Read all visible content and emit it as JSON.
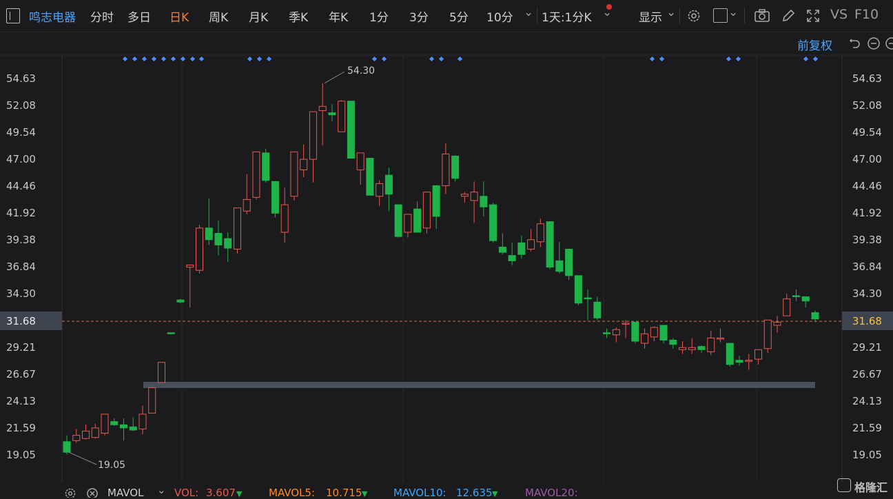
{
  "toolbar": {
    "stock_name": "鸣志电器",
    "periods": [
      "分时",
      "多日",
      "日K",
      "周K",
      "月K",
      "季K",
      "年K",
      "1分",
      "3分",
      "5分",
      "10分"
    ],
    "active_period": "日K",
    "interval": "1天:1分K",
    "display": "显示",
    "vs": "VS",
    "f10": "F10"
  },
  "chart_toolbar": {
    "adjust": "前复权"
  },
  "y_axis": {
    "ticks": [
      "54.63",
      "52.08",
      "49.54",
      "47.00",
      "44.46",
      "41.92",
      "39.38",
      "36.84",
      "34.30",
      "31.68",
      "29.21",
      "26.67",
      "24.13",
      "21.59",
      "19.05"
    ]
  },
  "annotations": {
    "high_label": "54.30",
    "low_label": "19.05",
    "current_price": "31.68"
  },
  "bottom_bar": {
    "indicator": "MAVOL",
    "vol_label": "VOL:",
    "vol_value": "3.607",
    "mavol5_label": "MAVOL5:",
    "mavol5_value": "10.715",
    "mavol10_label": "MAVOL10:",
    "mavol10_value": "12.635",
    "mavol20_label": "MAVOL20:",
    "watermark": "格隆汇"
  },
  "colors": {
    "up": "#e85a50",
    "down": "#1fb34a",
    "accent": "#ff7a2f",
    "link": "#4aa3ff",
    "bg": "#1b1b1d"
  },
  "chart_data": {
    "type": "candlestick",
    "ylim": [
      19.05,
      54.63
    ],
    "candles": [
      [
        20.3,
        19.3,
        20.9,
        19.1
      ],
      [
        20.4,
        20.9,
        21.5,
        20.2
      ],
      [
        20.6,
        21.3,
        21.9,
        20.5
      ],
      [
        20.7,
        21.6,
        22.0,
        20.6
      ],
      [
        21.1,
        22.9,
        22.9,
        20.9
      ],
      [
        22.2,
        21.9,
        22.5,
        21.8
      ],
      [
        21.9,
        21.6,
        22.5,
        20.4
      ],
      [
        21.7,
        21.4,
        22.6,
        21.3
      ],
      [
        21.5,
        22.9,
        23.7,
        21.0
      ],
      [
        23.0,
        25.4,
        25.4,
        23.0
      ],
      [
        25.9,
        27.8,
        27.8,
        25.9
      ],
      [
        30.6,
        30.5,
        30.6,
        30.5
      ],
      [
        33.7,
        33.5,
        33.8,
        33.4
      ],
      [
        36.8,
        37.0,
        37.0,
        33.0
      ],
      [
        36.5,
        40.5,
        40.8,
        36.2
      ],
      [
        40.5,
        39.4,
        43.3,
        38.9
      ],
      [
        40.0,
        38.9,
        41.2,
        37.9
      ],
      [
        39.5,
        38.6,
        40.1,
        37.3
      ],
      [
        38.5,
        42.4,
        42.4,
        38.1
      ],
      [
        42.1,
        43.2,
        45.6,
        41.8
      ],
      [
        43.4,
        47.7,
        47.7,
        43.2
      ],
      [
        47.6,
        45.0,
        48.0,
        44.8
      ],
      [
        44.9,
        41.9,
        44.9,
        41.5
      ],
      [
        40.1,
        42.7,
        44.3,
        39.1
      ],
      [
        43.5,
        47.7,
        47.7,
        43.1
      ],
      [
        46.0,
        47.0,
        48.4,
        45.3
      ],
      [
        47.0,
        51.5,
        51.5,
        44.8
      ],
      [
        51.6,
        52.0,
        54.2,
        48.3
      ],
      [
        51.4,
        51.2,
        52.2,
        50.6
      ],
      [
        49.6,
        52.5,
        52.6,
        49.6
      ],
      [
        52.5,
        47.1,
        52.5,
        47.1
      ],
      [
        46.0,
        47.6,
        47.6,
        44.6
      ],
      [
        47.1,
        43.6,
        47.1,
        43.6
      ],
      [
        43.5,
        44.7,
        45.0,
        42.6
      ],
      [
        45.5,
        43.7,
        46.2,
        42.1
      ],
      [
        42.7,
        39.7,
        42.7,
        39.6
      ],
      [
        40.1,
        41.8,
        41.8,
        39.6
      ],
      [
        42.3,
        40.1,
        43.0,
        40.1
      ],
      [
        40.5,
        43.9,
        43.9,
        40.0
      ],
      [
        44.5,
        41.6,
        44.5,
        40.4
      ],
      [
        44.5,
        47.5,
        48.5,
        43.7
      ],
      [
        47.3,
        45.2,
        47.4,
        44.9
      ],
      [
        43.5,
        43.7,
        43.9,
        42.9
      ],
      [
        43.1,
        43.9,
        44.9,
        41.0
      ],
      [
        43.5,
        42.5,
        44.9,
        41.6
      ],
      [
        42.7,
        39.3,
        42.9,
        39.1
      ],
      [
        38.7,
        38.2,
        40.0,
        38.0
      ],
      [
        37.9,
        37.4,
        39.1,
        37.0
      ],
      [
        39.1,
        38.0,
        39.8,
        37.6
      ],
      [
        38.5,
        39.4,
        40.4,
        38.3
      ],
      [
        39.2,
        40.9,
        41.4,
        38.7
      ],
      [
        41.1,
        36.8,
        41.1,
        36.6
      ],
      [
        37.4,
        36.4,
        39.2,
        36.2
      ],
      [
        38.5,
        36.0,
        38.5,
        35.6
      ],
      [
        36.0,
        33.4,
        36.0,
        33.2
      ],
      [
        33.9,
        33.8,
        34.7,
        31.8
      ],
      [
        33.5,
        32.0,
        34.0,
        31.8
      ],
      [
        30.6,
        30.5,
        31.0,
        30.1
      ],
      [
        30.4,
        30.9,
        31.1,
        29.7
      ],
      [
        31.5,
        31.5,
        31.8,
        30.1
      ],
      [
        31.6,
        29.8,
        31.6,
        29.6
      ],
      [
        29.6,
        30.5,
        31.0,
        29.1
      ],
      [
        30.2,
        31.1,
        31.2,
        29.8
      ],
      [
        31.3,
        29.9,
        31.3,
        29.6
      ],
      [
        29.9,
        29.5,
        30.1,
        29.1
      ],
      [
        29.0,
        29.2,
        29.8,
        28.6
      ],
      [
        29.0,
        29.2,
        30.1,
        28.6
      ],
      [
        29.3,
        29.0,
        29.4,
        28.7
      ],
      [
        28.8,
        30.1,
        30.8,
        28.5
      ],
      [
        30.0,
        30.1,
        31.0,
        29.7
      ],
      [
        29.6,
        27.6,
        29.6,
        27.4
      ],
      [
        28.0,
        27.8,
        28.4,
        27.5
      ],
      [
        27.9,
        28.0,
        28.6,
        27.1
      ],
      [
        28.1,
        29.0,
        29.0,
        27.6
      ],
      [
        29.1,
        31.8,
        31.8,
        28.7
      ],
      [
        31.3,
        31.6,
        32.2,
        30.6
      ],
      [
        32.2,
        33.8,
        34.3,
        32.2
      ],
      [
        34.1,
        34.0,
        34.7,
        33.6
      ],
      [
        34.0,
        33.6,
        34.0,
        33.0
      ],
      [
        32.5,
        31.9,
        32.7,
        31.6
      ]
    ]
  }
}
